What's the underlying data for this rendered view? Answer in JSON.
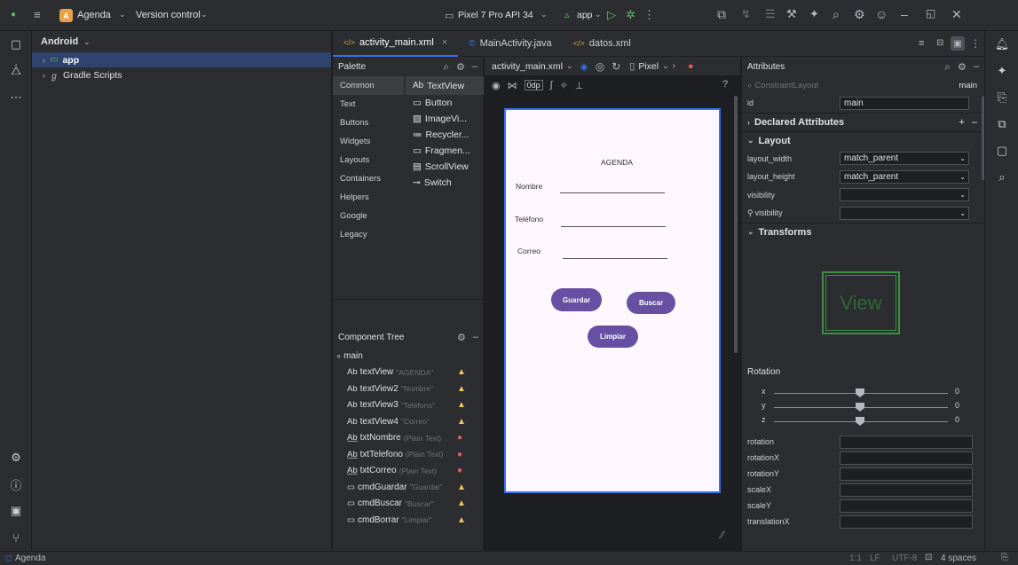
{
  "titlebar": {
    "project_badge": "A",
    "project_name": "Agenda",
    "vcs": "Version control",
    "device": "Pixel 7 Pro API 34",
    "run_config": "app"
  },
  "project_panel": {
    "view": "Android",
    "items": [
      "app",
      "Gradle Scripts"
    ]
  },
  "tabs": [
    {
      "label": "activity_main.xml",
      "icon": "xml-icon"
    },
    {
      "label": "MainActivity.java",
      "icon": "class-icon"
    },
    {
      "label": "datos.xml",
      "icon": "xml-icon"
    }
  ],
  "palette": {
    "title": "Palette",
    "categories": [
      "Common",
      "Text",
      "Buttons",
      "Widgets",
      "Layouts",
      "Containers",
      "Helpers",
      "Google",
      "Legacy"
    ],
    "widgets": [
      "TextView",
      "Button",
      "ImageVi...",
      "Recycler...",
      "Fragmen...",
      "ScrollView",
      "Switch"
    ],
    "widget_prefix": "Ab"
  },
  "component_tree": {
    "title": "Component Tree",
    "root": "main",
    "items": [
      {
        "name": "textView",
        "hint": "\"AGENDA\"",
        "status": "warn"
      },
      {
        "name": "textView2",
        "hint": "\"Nombre\"",
        "status": "warn"
      },
      {
        "name": "textView3",
        "hint": "\"Teléfono\"",
        "status": "warn"
      },
      {
        "name": "textView4",
        "hint": "\"Correo\"",
        "status": "warn"
      },
      {
        "name": "txtNombre",
        "hint": "(Plain Text)",
        "status": "err"
      },
      {
        "name": "txtTelefono",
        "hint": "(Plain Text)",
        "status": "err"
      },
      {
        "name": "txtCorreo",
        "hint": "(Plain Text)",
        "status": "err"
      },
      {
        "name": "cmdGuardar",
        "hint": "\"Guardar\"",
        "status": "warn"
      },
      {
        "name": "cmdBuscar",
        "hint": "\"Buscar\"",
        "status": "warn"
      },
      {
        "name": "cmdBorrar",
        "hint": "\"Limpiar\"",
        "status": "warn"
      }
    ]
  },
  "design_toolbar": {
    "file": "activity_main.xml",
    "device": "Pixel",
    "margin": "0dp",
    "help": "?"
  },
  "phone": {
    "title": "AGENDA",
    "labels": [
      "Nombre",
      "Teléfono",
      "Correo"
    ],
    "buttons": {
      "guardar": "Guardar",
      "buscar": "Buscar",
      "limpiar": "Limpiar"
    }
  },
  "attributes": {
    "title": "Attributes",
    "layout_type": "ConstraintLayout",
    "layout_id": "main",
    "id_label": "id",
    "id_value": "main",
    "sections": {
      "declared": "Declared Attributes",
      "layout": "Layout",
      "transforms": "Transforms"
    },
    "layout_rows": [
      {
        "label": "layout_width",
        "value": "match_parent"
      },
      {
        "label": "layout_height",
        "value": "match_parent"
      },
      {
        "label": "visibility",
        "value": ""
      },
      {
        "label": "visibility",
        "value": ""
      }
    ],
    "preview_text": "View",
    "rotation_title": "Rotation",
    "rotation": [
      {
        "axis": "x",
        "value": "0"
      },
      {
        "axis": "y",
        "value": "0"
      },
      {
        "axis": "z",
        "value": "0"
      }
    ],
    "transform_rows": [
      "rotation",
      "rotationX",
      "rotationY",
      "scaleX",
      "scaleY",
      "translationX"
    ]
  },
  "statusbar": {
    "project": "Agenda",
    "position": "1:1",
    "line_sep": "LF",
    "encoding": "UTF-8",
    "indent": "4 spaces"
  }
}
